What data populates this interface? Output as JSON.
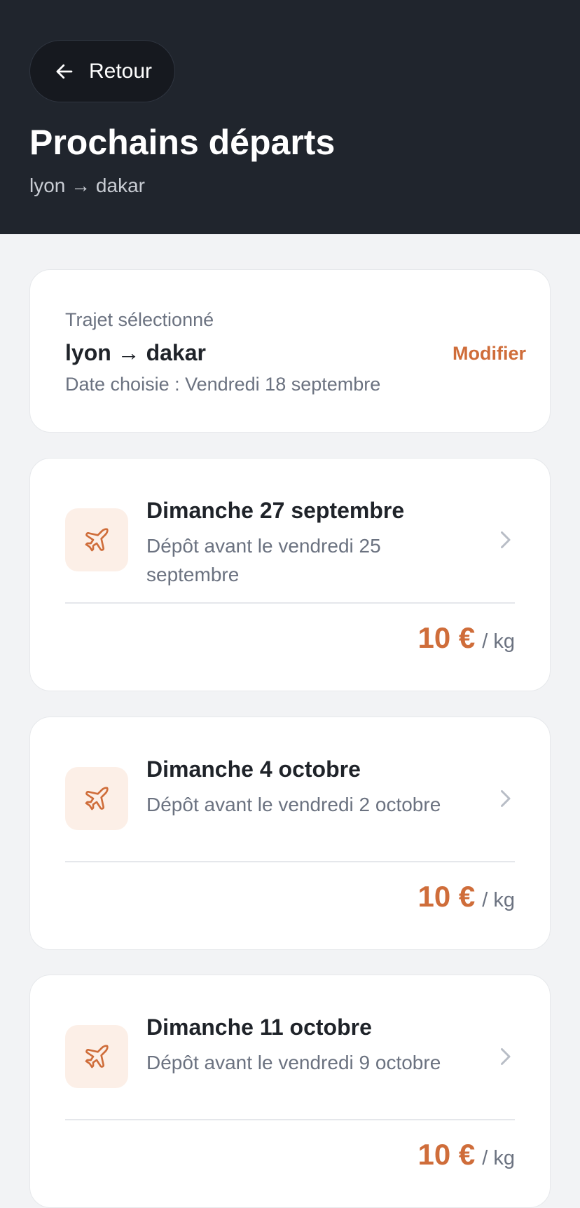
{
  "header": {
    "back_label": "Retour",
    "title": "Prochains départs",
    "route": "lyon → dakar"
  },
  "summary": {
    "caption": "Trajet sélectionné",
    "route": "lyon → dakar",
    "date": "Date choisie : Vendredi 18 septembre",
    "modify_label": "Modifier"
  },
  "departures": [
    {
      "date": "Dimanche 27 septembre",
      "deadline": "Dépôt avant le vendredi 25 septembre",
      "price": "10 €",
      "unit": "/ kg"
    },
    {
      "date": "Dimanche 4 octobre",
      "deadline": "Dépôt avant le vendredi 2 octobre",
      "price": "10 €",
      "unit": "/ kg"
    },
    {
      "date": "Dimanche 11 octobre",
      "deadline": "Dépôt avant le vendredi 9 octobre",
      "price": "10 €",
      "unit": "/ kg"
    }
  ],
  "colors": {
    "header_bg": "#20252d",
    "accent": "#cf6d3a",
    "icon_bg": "#fcefe7",
    "page_bg": "#f2f3f5"
  },
  "icons": {
    "back": "arrow-left-icon",
    "departure": "plane-icon",
    "open": "chevron-right-icon"
  }
}
